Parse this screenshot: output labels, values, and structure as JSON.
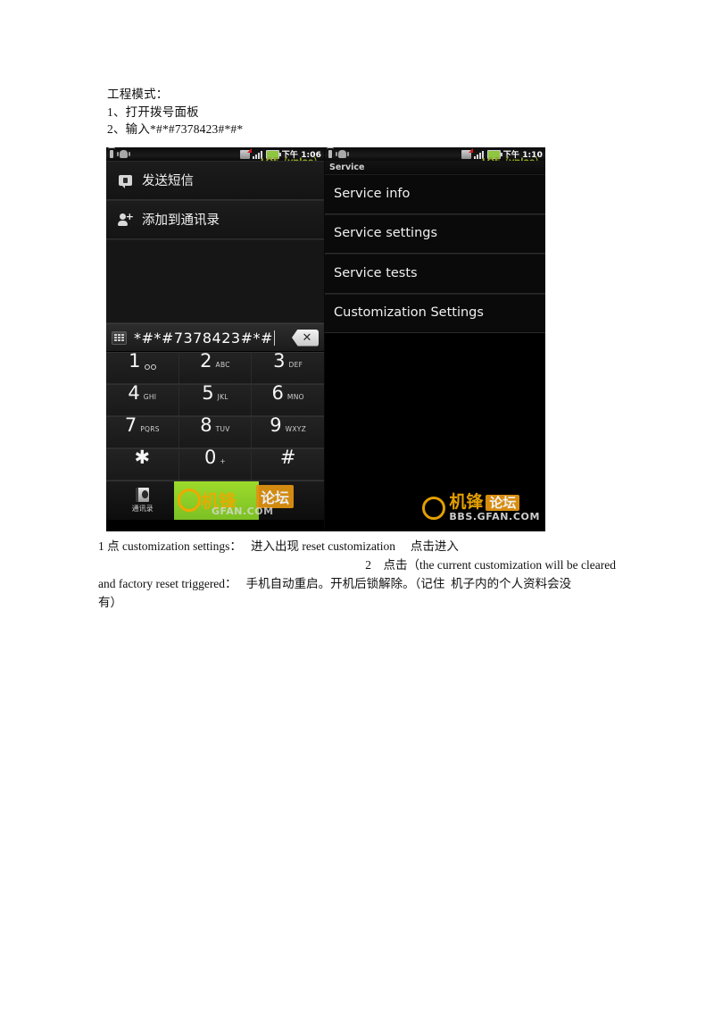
{
  "document": {
    "intro": {
      "heading": "工程模式：",
      "steps": [
        "1、打开拨号面板",
        "2、输入*#*#7378423#*#*"
      ]
    },
    "caption": {
      "line1": "1 点 customization settings：   进入出现 reset customization     点击进入",
      "line2": "2    点击（the current customization will be cleared",
      "line3": "and factory reset triggered：   手机自动重启。开机后锁解除。（记住  机子内的个人资料会没",
      "line4": "有）"
    }
  },
  "left_phone": {
    "statusbar": {
      "icons_left": [
        "usb-icon",
        "android-robot-icon"
      ],
      "icons_right": [
        "sd-card-error-icon",
        "signal-bars-icon",
        "battery-icon"
      ],
      "time": "下午 1:06",
      "watermark": "LOE（ynloe）"
    },
    "menu_items": [
      {
        "icon": "sms-icon",
        "label": "发送短信"
      },
      {
        "icon": "add-contact-icon",
        "label": "添加到通讯录"
      }
    ],
    "dialer": {
      "keypad_toggle_icon": "keypad-icon",
      "number": "*#*#7378423#*#",
      "backspace_icon": "backspace-icon",
      "backspace_glyph": "✕"
    },
    "keypad": [
      [
        {
          "digit": "1",
          "sub": "",
          "icon": "voicemail-icon"
        },
        {
          "digit": "2",
          "sub": "ABC",
          "icon": ""
        },
        {
          "digit": "3",
          "sub": "DEF",
          "icon": ""
        }
      ],
      [
        {
          "digit": "4",
          "sub": "GHI",
          "icon": ""
        },
        {
          "digit": "5",
          "sub": "JKL",
          "icon": ""
        },
        {
          "digit": "6",
          "sub": "MNO",
          "icon": ""
        }
      ],
      [
        {
          "digit": "7",
          "sub": "PQRS",
          "icon": ""
        },
        {
          "digit": "8",
          "sub": "TUV",
          "icon": ""
        },
        {
          "digit": "9",
          "sub": "WXYZ",
          "icon": ""
        }
      ],
      [
        {
          "digit": "✱",
          "sub": "",
          "icon": ""
        },
        {
          "digit": "0",
          "sub": "+",
          "icon": ""
        },
        {
          "digit": "#",
          "sub": "",
          "icon": ""
        }
      ]
    ],
    "tabbar": {
      "contacts_label": "通讯录",
      "contacts_icon": "contacts-icon"
    },
    "watermark": {
      "brand": "机锋",
      "forum": "论坛",
      "domain": "GFAN.COM"
    }
  },
  "right_phone": {
    "statusbar": {
      "icons_left": [
        "usb-icon",
        "android-robot-icon"
      ],
      "icons_right": [
        "sd-card-error-icon",
        "signal-bars-icon",
        "battery-icon"
      ],
      "time": "下午 1:10",
      "watermark": "LOE（ynloe）"
    },
    "title": "Service",
    "menu_items": [
      "Service info",
      "Service settings",
      "Service tests",
      "Customization Settings"
    ],
    "watermark": {
      "brand": "机锋",
      "forum": "论坛",
      "domain": "BBS.GFAN.COM"
    }
  },
  "colors": {
    "page_bg": "#ffffff",
    "phone_bg": "#000000",
    "accent_green": "#8ec63f",
    "accent_orange": "#f0a800",
    "text": "#111111"
  }
}
